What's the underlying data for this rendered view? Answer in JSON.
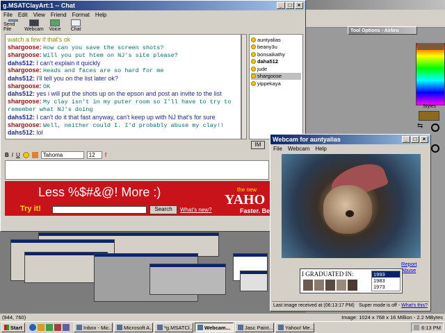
{
  "chat_window": {
    "title": "g.MSATClayArt:1 -- Chat",
    "menus": [
      "File",
      "Edit",
      "View",
      "Friend",
      "Format",
      "Help"
    ],
    "tools": [
      "Send File",
      "Webcam",
      "Voice",
      "Chat"
    ],
    "messages": [
      {
        "who": "",
        "text": "watch a few if that's ok",
        "style": "olive"
      },
      {
        "who": "shargoose:",
        "text": "How can you save the screen shots?",
        "style": "mono"
      },
      {
        "who": "shargoose:",
        "text": "Will you put htem on NJ's site please?",
        "style": "mono"
      },
      {
        "who": "dahs512:",
        "text": "I can't explain it quickly",
        "style": "sans"
      },
      {
        "who": "shargoose:",
        "text": "Heads and faces are so hard for me",
        "style": "mono"
      },
      {
        "who": "dahs512:",
        "text": "I'll tell you on the list later ok?",
        "style": "sans"
      },
      {
        "who": "shargoose:",
        "text": "OK",
        "style": "mono"
      },
      {
        "who": "dahs512:",
        "text": "yes i will put the shots up on the epson and post an invite to the list",
        "style": "sans"
      },
      {
        "who": "shargoose:",
        "text": "My clay isn't in my puter room so I'll have to try to remember what NJ's doing",
        "style": "mono"
      },
      {
        "who": "dahs512:",
        "text": "I can't do it that fast anyway, can't keep up with NJ that's for sure",
        "style": "sans"
      },
      {
        "who": "shargoose:",
        "text": "Well, neither could I. I'd probably abuse my clay!!",
        "style": "mono"
      },
      {
        "who": "dahs512:",
        "text": "lol",
        "style": "sans"
      }
    ],
    "buddies": [
      {
        "name": "auntyalias",
        "bold": false,
        "sel": false
      },
      {
        "name": "beany3u",
        "bold": false,
        "sel": false
      },
      {
        "name": "bonsaikathy",
        "bold": false,
        "sel": false
      },
      {
        "name": "daha512",
        "bold": true,
        "sel": false
      },
      {
        "name": "jude",
        "bold": false,
        "sel": false
      },
      {
        "name": "shargoose",
        "bold": false,
        "sel": true
      },
      {
        "name": "yippekaya",
        "bold": false,
        "sel": false
      }
    ],
    "format": {
      "font": "Tahoma",
      "size": "12"
    },
    "im_button": "IM"
  },
  "ad": {
    "headline": "Less %$#&@! More :)",
    "try_it": "Try it!",
    "search_btn": "Search",
    "whats_new": "What's new?",
    "the_new": "the new",
    "brand": "YAHO",
    "tagline": "Faster. Be"
  },
  "webcam": {
    "title": "Webcam for auntyalias",
    "menus": [
      "File",
      "Webcam",
      "Help"
    ],
    "report": "Report Abuse",
    "graduated": "I GRADUATED IN:",
    "years": [
      "1993",
      "1983",
      "1973"
    ],
    "last_image": "Last image received at (06:13:17 PM)",
    "super_mode": "Super mode is off -",
    "whats_this": "What's this?"
  },
  "tool_options": "Tool Options - Airbru",
  "styles_label": "Styles",
  "status": {
    "coords": "(944, 760)",
    "image": "Image:  1024 x 768 x 16 Million - 2.2 MBytes"
  },
  "taskbar": {
    "start": "Start",
    "items": [
      "Inbox - Mic...",
      "Microsoft A...",
      "*g.MSATCl...",
      "Webcam...",
      "Jasc Paint...",
      "Yahoo! Me..."
    ],
    "active_index": 3,
    "clock": "6:13 PM"
  },
  "colors": {
    "titlebar": "#0a246a",
    "ad_red": "#c8131b",
    "window": "#d4d0c8"
  }
}
